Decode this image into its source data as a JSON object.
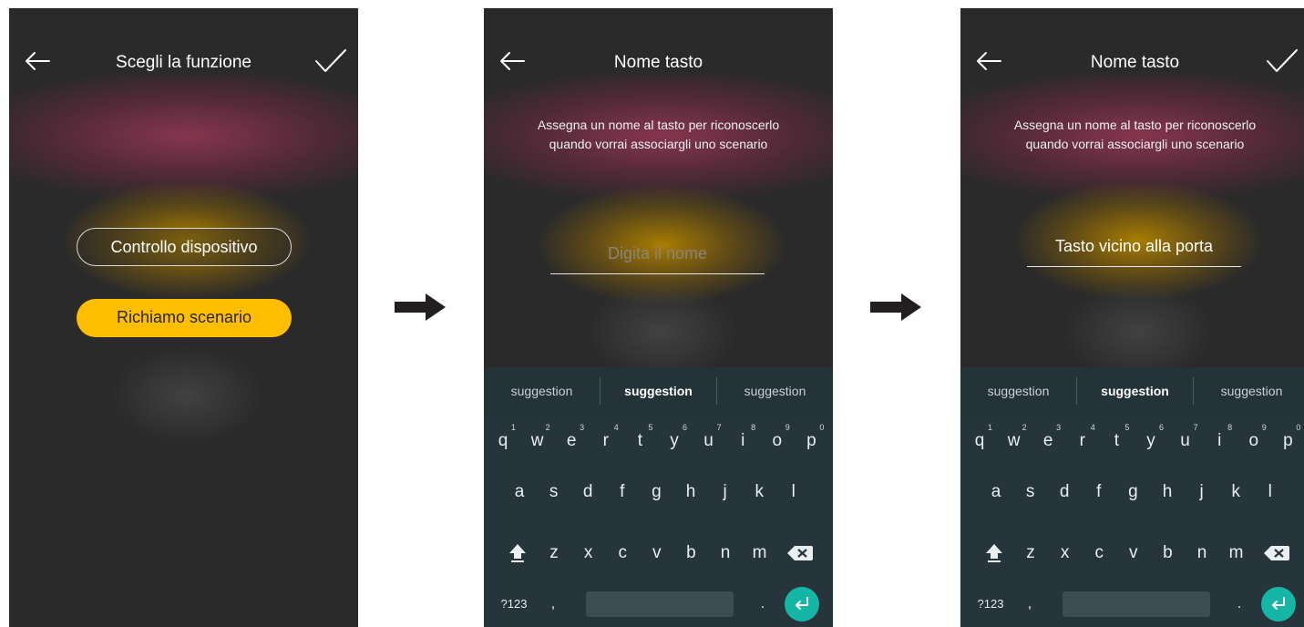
{
  "screen1": {
    "title": "Scegli la funzione",
    "option_device": "Controllo dispositivo",
    "option_scenario": "Richiamo scenario"
  },
  "screen2": {
    "title": "Nome tasto",
    "description_line1": "Assegna un nome al tasto per riconoscerlo",
    "description_line2": "quando vorrai associargli uno scenario",
    "name_placeholder": "Digita il nome",
    "name_value": ""
  },
  "screen3": {
    "title": "Nome tasto",
    "description_line1": "Assegna un nome al tasto per riconoscerlo",
    "description_line2": "quando vorrai associargli uno scenario",
    "name_value": "Tasto vicino alla porta"
  },
  "keyboard": {
    "suggestions": [
      "suggestion",
      "suggestion",
      "suggestion"
    ],
    "row1": [
      {
        "k": "q",
        "n": "1"
      },
      {
        "k": "w",
        "n": "2"
      },
      {
        "k": "e",
        "n": "3"
      },
      {
        "k": "r",
        "n": "4"
      },
      {
        "k": "t",
        "n": "5"
      },
      {
        "k": "y",
        "n": "6"
      },
      {
        "k": "u",
        "n": "7"
      },
      {
        "k": "i",
        "n": "8"
      },
      {
        "k": "o",
        "n": "9"
      },
      {
        "k": "p",
        "n": "0"
      }
    ],
    "row2": [
      "a",
      "s",
      "d",
      "f",
      "g",
      "h",
      "j",
      "k",
      "l"
    ],
    "row3": [
      "z",
      "x",
      "c",
      "v",
      "b",
      "n",
      "m"
    ],
    "mode_label": "?123",
    "comma_label": ",",
    "dot_label": "."
  },
  "icons": {
    "back": "back-arrow-icon",
    "confirm": "checkmark-icon",
    "shift": "shift-icon",
    "delete": "backspace-icon",
    "enter": "enter-icon",
    "flow_arrow": "right-arrow-icon"
  },
  "colors": {
    "background": "#2a2a2a",
    "accent_yellow": "#ffbe00",
    "keyboard_bg": "#25353b",
    "enter_teal": "#16b6a6"
  }
}
